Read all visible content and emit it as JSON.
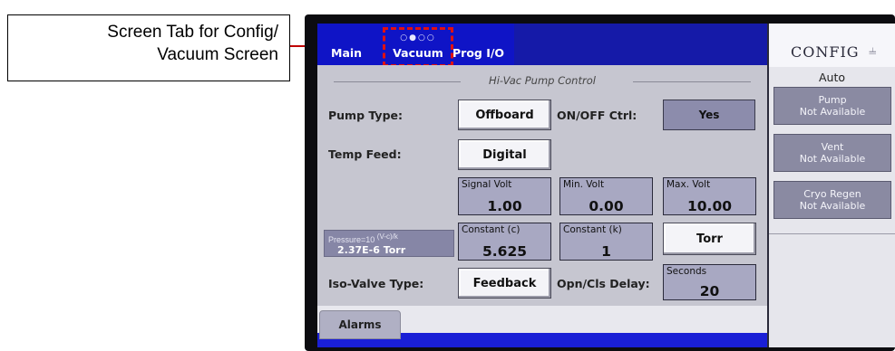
{
  "callout": {
    "line1": "Screen Tab for Config/",
    "line2": "Vacuum Screen"
  },
  "tabs": {
    "main": "Main",
    "vacuum": "Vacuum",
    "vacuum_dots": "○●○○",
    "prog": "Prog I/O"
  },
  "panel": {
    "title": "Hi-Vac Pump Control",
    "pump_type_label": "Pump Type:",
    "pump_type_value": "Offboard",
    "onoff_label": "ON/OFF Ctrl:",
    "onoff_value": "Yes",
    "temp_feed_label": "Temp Feed:",
    "temp_feed_value": "Digital",
    "signal_volt": {
      "caption": "Signal Volt",
      "value": "1.00"
    },
    "min_volt": {
      "caption": "Min. Volt",
      "value": "0.00"
    },
    "max_volt": {
      "caption": "Max. Volt",
      "value": "10.00"
    },
    "pressure_formula": "Pressure=10",
    "pressure_exp": "(V-c)/k",
    "pressure_value": "2.37E-6 Torr",
    "constant_c": {
      "caption": "Constant (c)",
      "value": "5.625"
    },
    "constant_k": {
      "caption": "Constant (k)",
      "value": "1"
    },
    "units_button": "Torr",
    "iso_label": "Iso-Valve Type:",
    "iso_value": "Feedback",
    "delay_label": "Opn/Cls Delay:",
    "delay": {
      "caption": "Seconds",
      "value": "20"
    }
  },
  "footer": {
    "alarms": "Alarms"
  },
  "config": {
    "title": "CONFIG",
    "chevron": "chevron-down-icon",
    "mode": "Auto",
    "buttons": [
      {
        "line1": "Pump",
        "line2": "Not Available"
      },
      {
        "line1": "Vent",
        "line2": "Not Available"
      },
      {
        "line1": "Cryo Regen",
        "line2": "Not Available"
      }
    ]
  },
  "colors": {
    "tab_blue": "#1a1fd6",
    "panel_gray": "#c6c6d0",
    "highlight_red": "#e01010"
  }
}
